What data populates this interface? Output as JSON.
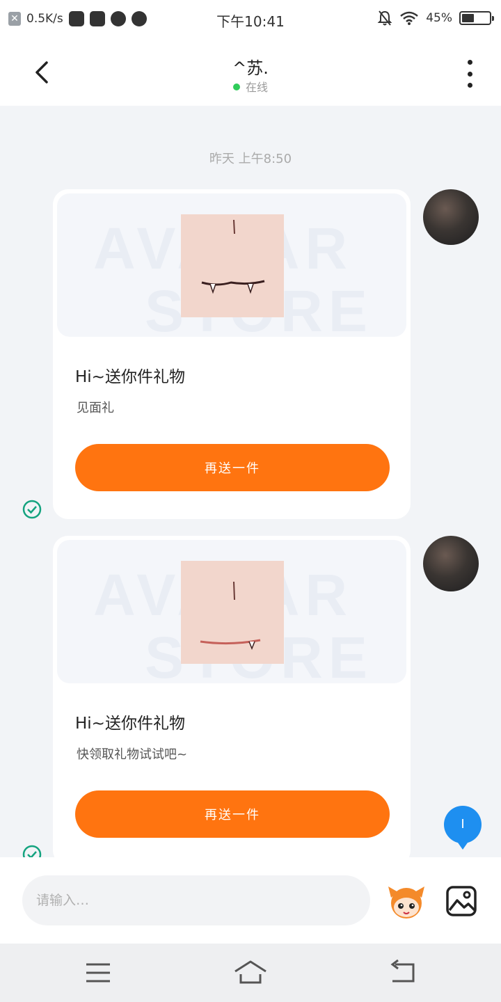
{
  "status_bar": {
    "net_speed": "0.5K/s",
    "time": "下午10:41",
    "battery_text": "45%",
    "battery_level": 0.45,
    "icons": [
      "close-icon",
      "mail-icon",
      "fan-icon",
      "planet-icon",
      "play-icon",
      "bell-off-icon",
      "wifi-icon",
      "battery-icon"
    ]
  },
  "header": {
    "back_icon": "back-arrow-icon",
    "title": "^苏.",
    "status": "在线",
    "status_color": "#2fcc5a",
    "more_icon": "more-vertical-icon"
  },
  "chat": {
    "timestamp": "昨天 上午8:50",
    "messages": [
      {
        "title": "Hi~送你件礼物",
        "subtitle": "见面礼",
        "button": "再送一件",
        "watermark_line1": "AVATAR",
        "watermark_line2": "STORE",
        "sent_icon": "check-circle-icon"
      },
      {
        "title": "Hi~送你件礼物",
        "subtitle": "快领取礼物试试吧~",
        "button": "再送一件",
        "watermark_line1": "AVATAR",
        "watermark_line2": "STORE",
        "sent_icon": "check-circle-icon"
      }
    ],
    "float_button": "I",
    "accent_color": "#ff7410"
  },
  "input_bar": {
    "placeholder": "请输入…",
    "emoji_icon": "mascot-emoji-icon",
    "image_icon": "image-icon"
  },
  "nav_bar": {
    "icons": [
      "menu-icon",
      "home-icon",
      "back-icon"
    ]
  }
}
